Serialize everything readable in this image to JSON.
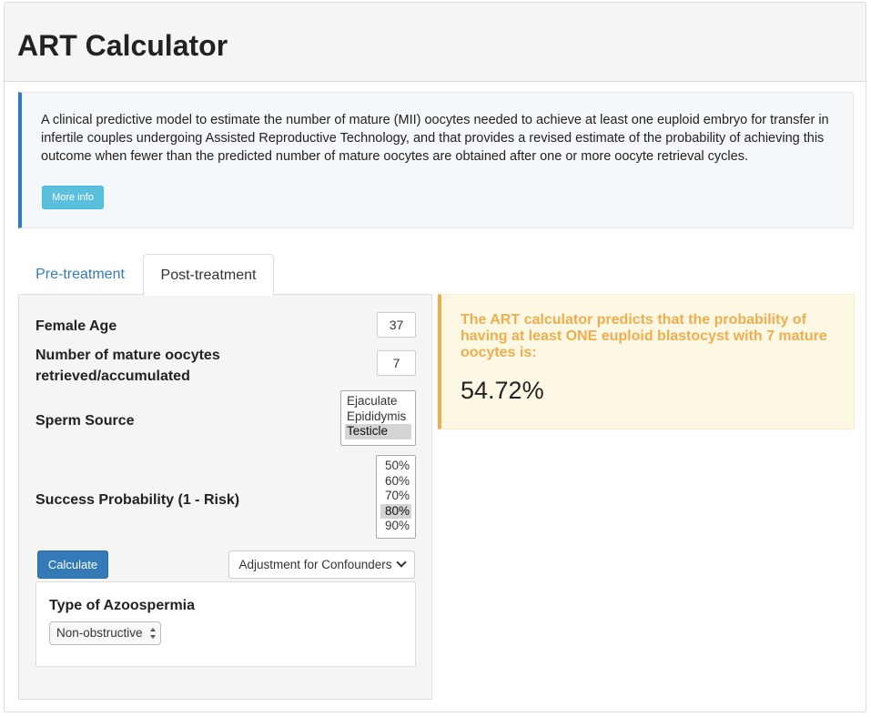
{
  "header": {
    "title": "ART Calculator"
  },
  "info": {
    "description": "A clinical predictive model to estimate the number of mature (MII) oocytes needed to achieve at least one euploid embryo for transfer in infertile couples undergoing Assisted Reproductive Technology, and that provides a revised estimate of the probability of achieving this outcome when fewer than the predicted number of mature oocytes are obtained after one or more oocyte retrieval cycles.",
    "more_info_label": "More info"
  },
  "tabs": [
    {
      "label": "Pre-treatment",
      "active": false
    },
    {
      "label": "Post-treatment",
      "active": true
    }
  ],
  "form": {
    "female_age": {
      "label": "Female Age",
      "value": "37"
    },
    "oocytes": {
      "label": "Number of mature oocytes retrieved/accumulated",
      "value": "7"
    },
    "sperm_source": {
      "label": "Sperm Source",
      "options": [
        "Ejaculate",
        "Epididymis",
        "Testicle"
      ],
      "selected": "Testicle"
    },
    "success_probability": {
      "label": "Success Probability (1 - Risk)",
      "options": [
        "50%",
        "60%",
        "70%",
        "80%",
        "90%"
      ],
      "selected": "80%"
    },
    "calculate_label": "Calculate",
    "adjustment_label": "Adjustment for Confounders"
  },
  "confounders": {
    "title": "Type of Azoospermia",
    "azoospermia_value": "Non-obstructive"
  },
  "result": {
    "text": "The ART calculator predicts that the probability of having at least ONE euploid blastocyst with 7 mature oocytes is:",
    "value": "54.72%"
  },
  "colors": {
    "primary": "#337ab7",
    "info_button": "#5bc0de",
    "warning": "#f0ad4e",
    "warning_bg": "#fcf8e3"
  }
}
